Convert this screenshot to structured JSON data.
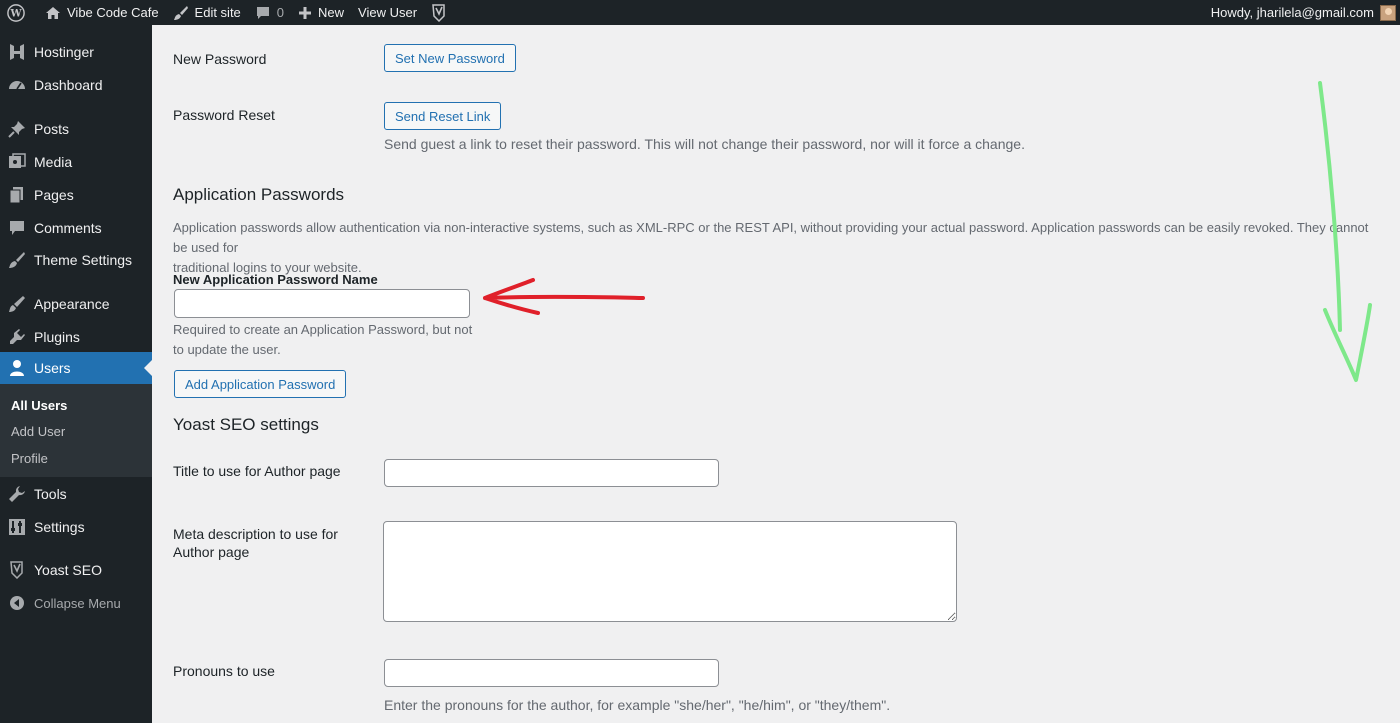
{
  "adminbar": {
    "site_name": "Vibe Code Cafe",
    "edit_site": "Edit site",
    "comments_count": "0",
    "new_label": "New",
    "view_user": "View User",
    "howdy": "Howdy, jharilela@gmail.com"
  },
  "sidebar": {
    "items": [
      {
        "label": "Hostinger",
        "icon": "hostinger-icon"
      },
      {
        "label": "Dashboard",
        "icon": "dashboard-icon"
      },
      {
        "label": "Posts",
        "icon": "pushpin-icon"
      },
      {
        "label": "Media",
        "icon": "media-icon"
      },
      {
        "label": "Pages",
        "icon": "pages-icon"
      },
      {
        "label": "Comments",
        "icon": "comment-icon"
      },
      {
        "label": "Theme Settings",
        "icon": "brush-icon"
      },
      {
        "label": "Appearance",
        "icon": "appearance-icon"
      },
      {
        "label": "Plugins",
        "icon": "plugin-icon"
      },
      {
        "label": "Users",
        "icon": "user-icon"
      },
      {
        "label": "Tools",
        "icon": "wrench-icon"
      },
      {
        "label": "Settings",
        "icon": "settings-icon"
      },
      {
        "label": "Yoast SEO",
        "icon": "yoast-icon"
      }
    ],
    "submenu": [
      "All Users",
      "Add User",
      "Profile"
    ],
    "collapse": "Collapse Menu"
  },
  "form": {
    "new_password_label": "New Password",
    "set_new_password_button": "Set New Password",
    "password_reset_label": "Password Reset",
    "send_reset_link_button": "Send Reset Link",
    "reset_description": "Send guest a link to reset their password. This will not change their password, nor will it force a change.",
    "app_passwords_heading": "Application Passwords",
    "app_passwords_desc_line1": "Application passwords allow authentication via non-interactive systems, such as XML-RPC or the REST API, without providing your actual password. Application passwords can be easily revoked. They cannot be used for",
    "app_passwords_desc_line2": "traditional logins to your website.",
    "app_password_name_label": "New Application Password Name",
    "app_password_name_value": "",
    "app_password_help_line1": "Required to create an Application Password, but not",
    "app_password_help_line2": "to update the user.",
    "add_app_password_button": "Add Application Password",
    "yoast_heading": "Yoast SEO settings",
    "author_title_label": "Title to use for Author page",
    "author_title_value": "",
    "meta_desc_label_line1": "Meta description to use for",
    "meta_desc_label_line2": "Author page",
    "meta_desc_value": "",
    "pronouns_label": "Pronouns to use",
    "pronouns_value": "",
    "pronouns_description": "Enter the pronouns for the author, for example \"she/her\", \"he/him\", or \"they/them\"."
  },
  "colors": {
    "admin_dark": "#1d2327",
    "accent_blue": "#2271b1",
    "annotation_red": "#e0202a",
    "annotation_green": "#7ee88a"
  }
}
